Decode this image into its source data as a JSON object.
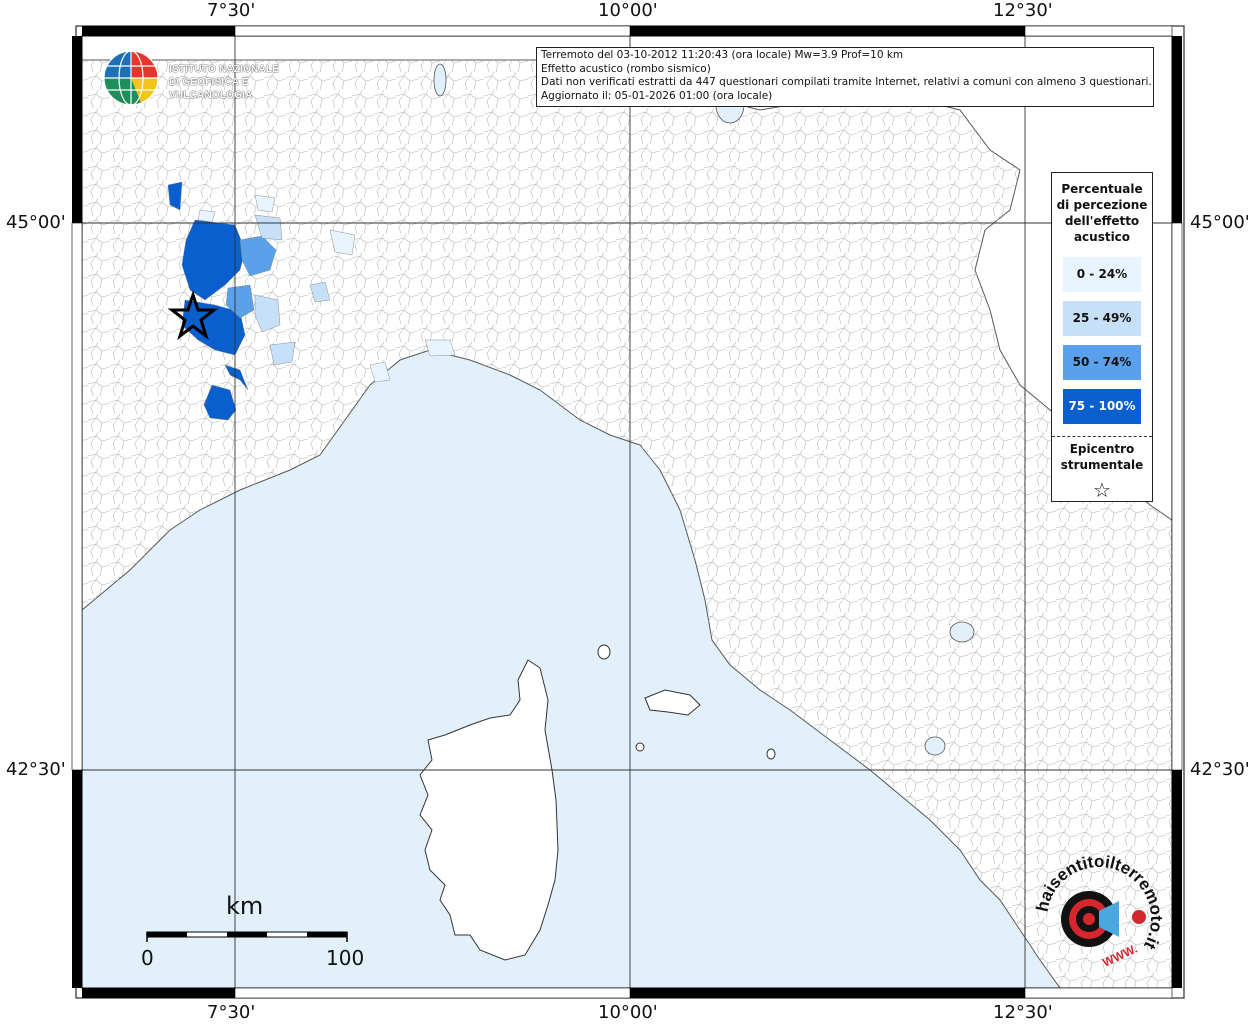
{
  "info": {
    "line1": "Terremoto del 03-10-2012 11:20:43 (ora locale) Mw=3.9 Prof=10 km",
    "line2": "Effetto acustico (rombo sismico)",
    "line3": "Dati non verificati estratti da 447 questionari compilati tramite Internet, relativi a comuni con almeno 3 questionari.",
    "line4": "Aggiornato il: 05-01-2026 01:00 (ora locale)"
  },
  "axes": {
    "top": [
      "7°30'",
      "10°00'",
      "12°30'"
    ],
    "bottom": [
      "7°30'",
      "10°00'",
      "12°30'"
    ],
    "left": [
      "45°00'",
      "42°30'"
    ],
    "right": [
      "45°00'",
      "42°30'"
    ]
  },
  "legend": {
    "title": "Percentuale di percezione dell'effetto acustico",
    "title_lines": [
      "Percentuale",
      "di percezione",
      "dell'effetto",
      "acustico"
    ],
    "classes": [
      {
        "label": "0 - 24%",
        "color": "#e8f4ff"
      },
      {
        "label": "25 - 49%",
        "color": "#c6e0f9"
      },
      {
        "label": "50 - 74%",
        "color": "#5aa0ea"
      },
      {
        "label": "75 - 100%",
        "color": "#0a5fcf"
      }
    ],
    "epicenter_lines": [
      "Epicentro",
      "strumentale"
    ],
    "epicenter_symbol": "☆"
  },
  "logo": {
    "line1": "ISTITUTO NAZIONALE",
    "line2": "DI GEOFISICA E VULCANOLOGIA"
  },
  "scale": {
    "unit": "km",
    "min": "0",
    "max": "100"
  },
  "haisentito": {
    "text": "haisentitoilterremoto.it",
    "www": "WWW.",
    "icon": "earthquake-ear-icon"
  },
  "colors": {
    "sea": "#e1f0fb",
    "land": "#ffffff",
    "border": "#aaaaaa",
    "frame": "#000000"
  }
}
